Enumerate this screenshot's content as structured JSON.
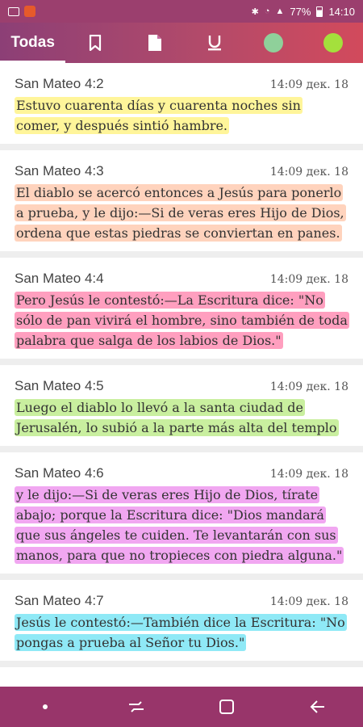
{
  "status": {
    "battery": "77%",
    "time": "14:10"
  },
  "tabs": {
    "all_label": "Todas",
    "dot1_color": "#8fd09a",
    "dot2_color": "#a4e03c"
  },
  "items": [
    {
      "ref": "San Mateo 4:2",
      "time": "14:09 дек. 18",
      "text": "Estuvo cuarenta días y cuarenta noches sin comer, y después sintió hambre.",
      "color": "#fff59a"
    },
    {
      "ref": "San Mateo 4:3",
      "time": "14:09 дек. 18",
      "text": "El diablo se acercó entonces a Jesús para ponerlo a prueba, y le dijo:—Si de veras eres Hijo de Dios, ordena que estas piedras se conviertan en panes.",
      "color": "#ffd3bd"
    },
    {
      "ref": "San Mateo 4:4",
      "time": "14:09 дек. 18",
      "text": "Pero Jesús le contestó:—La Escritura dice: \"No sólo de pan vivirá el hombre, sino también de toda palabra que salga de los labios de Dios.\"",
      "color": "#ff9fbf"
    },
    {
      "ref": "San Mateo 4:5",
      "time": "14:09 дек. 18",
      "text": "Luego el diablo lo llevó a la santa ciudad de Jerusalén, lo subió a la parte más alta del templo",
      "color": "#c9ef9f"
    },
    {
      "ref": "San Mateo 4:6",
      "time": "14:09 дек. 18",
      "text": "y le dijo:—Si de veras eres Hijo de Dios, tírate abajo; porque la Escritura dice: \"Dios mandará que sus ángeles te cuiden. Te levantarán con sus manos, para que no tropieces con piedra alguna.\"",
      "color": "#f1a7f1"
    },
    {
      "ref": "San Mateo 4:7",
      "time": "14:09 дек. 18",
      "text": "Jesús le contestó:—También dice la Escritura: \"No pongas a prueba al Señor tu Dios.\"",
      "color": "#8fe9f6"
    }
  ]
}
